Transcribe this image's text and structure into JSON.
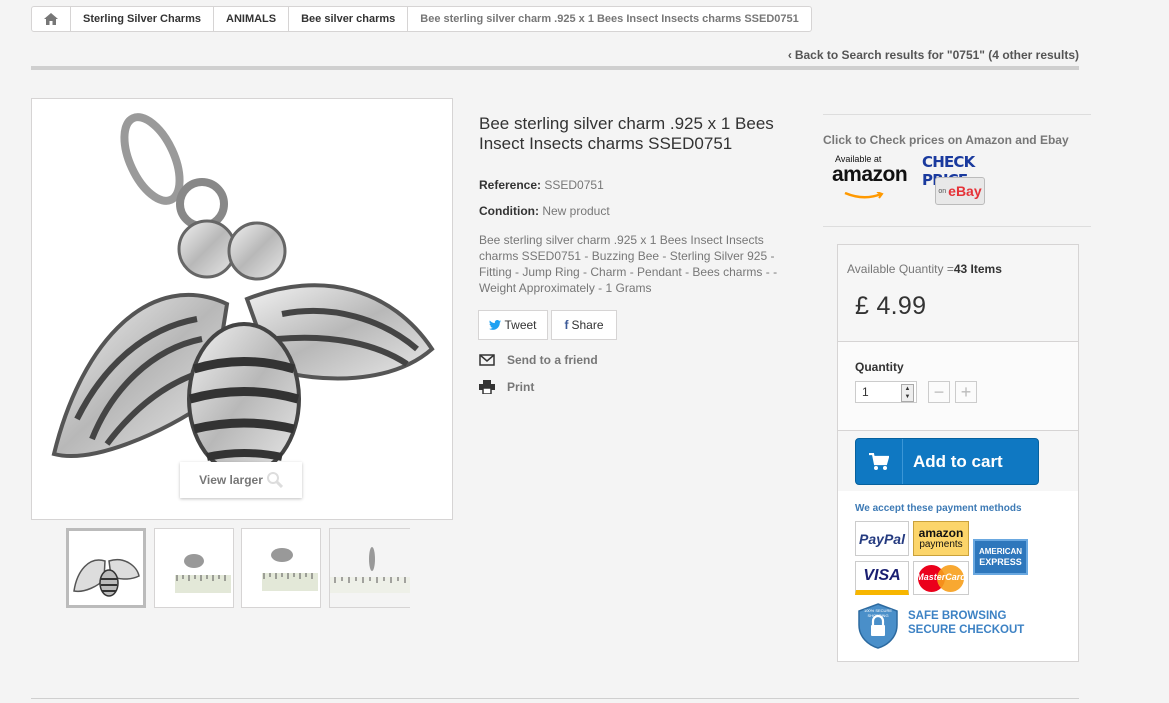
{
  "breadcrumb": {
    "items": [
      "Sterling Silver Charms",
      "ANIMALS",
      "Bee silver charms"
    ],
    "current": "Bee sterling silver charm .925 x 1 Bees Insect Insects charms SSED0751"
  },
  "back_link": "Back to Search results for \"0751\" (4 other results)",
  "image": {
    "view_larger": "View larger"
  },
  "product": {
    "title": "Bee sterling silver charm .925 x 1 Bees Insect Insects charms SSED0751",
    "reference_label": "Reference:",
    "reference": "SSED0751",
    "condition_label": "Condition:",
    "condition": "New product",
    "description": "Bee sterling silver charm .925 x 1 Bees Insect Insects charms SSED0751 - Buzzing Bee - Sterling Silver 925 - Fitting - Jump Ring - Charm - Pendant - Bees charms - - Weight Approximately - 1 Grams"
  },
  "social": {
    "tweet": "Tweet",
    "share": "Share"
  },
  "links": {
    "send": "Send to a friend",
    "print": "Print"
  },
  "partners": {
    "heading": "Click to Check prices on Amazon and Ebay",
    "amazon_small": "Available at",
    "amazon_logo": "amazon",
    "check_price": "CHECK PRICE",
    "ebay_small": "on",
    "ebay_logo": "eBay"
  },
  "buy": {
    "available_label": "Available Quantity =",
    "available_value": "43 Items",
    "price": "£ 4.99",
    "quantity_label": "Quantity",
    "quantity_value": "1",
    "minus": "−",
    "plus": "+",
    "add_to_cart": "Add to cart"
  },
  "payment": {
    "heading": "We accept these payment methods",
    "paypal": "PayPal",
    "amazon_top": "amazon",
    "amazon_bottom": "payments",
    "amex_top": "AMERICAN",
    "amex_bottom": "EXPRESS",
    "visa": "VISA",
    "mastercard": "MasterCard",
    "badge_small": "100% SECURE SHOPPING",
    "safe_line1": "SAFE BROWSING",
    "safe_line2": "SECURE CHECKOUT"
  },
  "colors": {
    "cart_blue": "#0f78c2",
    "amazon_orange": "#f90",
    "paypal_blue": "#253b80"
  }
}
